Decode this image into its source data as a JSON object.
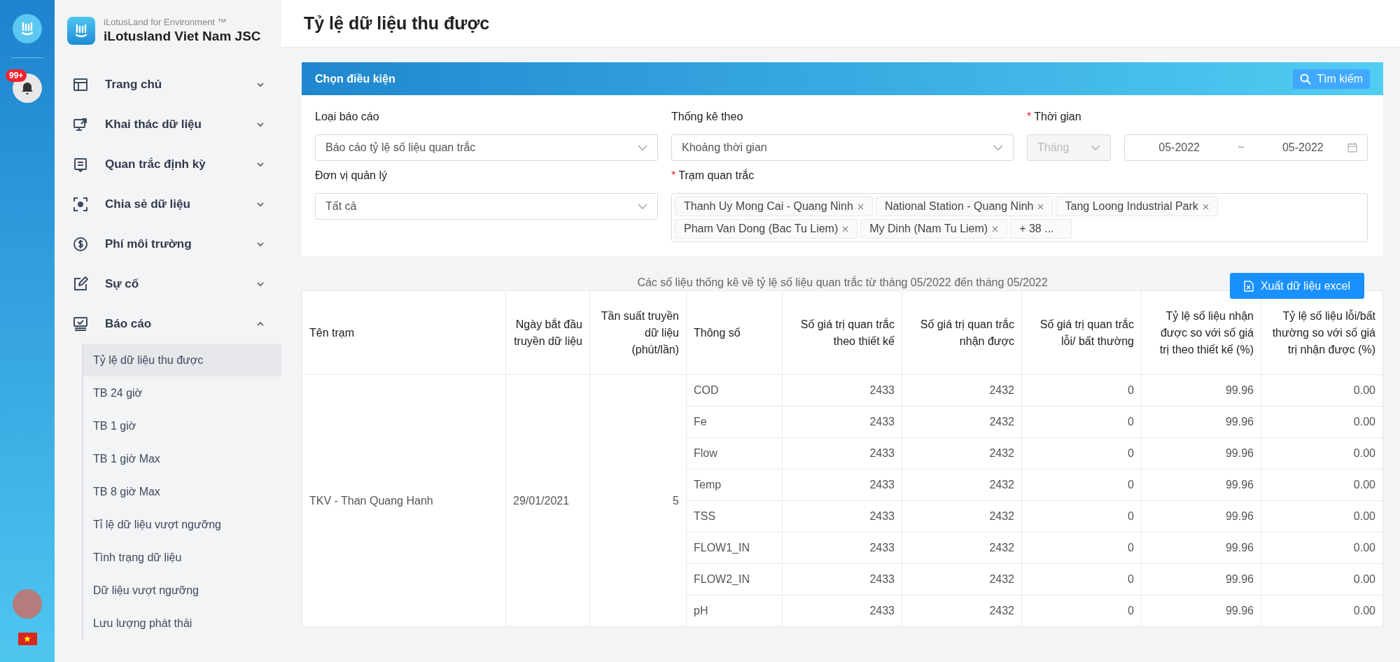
{
  "rail": {
    "notification_badge": "99+"
  },
  "sidebar": {
    "brand_subtitle": "iLotusLand for Environment ™",
    "brand_name": "iLotusland Viet Nam JSC",
    "items": [
      {
        "label": "Trang chủ",
        "kind": "layout",
        "expanded": false
      },
      {
        "label": "Khai thác dữ liệu",
        "kind": "monitor",
        "expanded": false
      },
      {
        "label": "Quan trắc định kỳ",
        "kind": "note",
        "expanded": false
      },
      {
        "label": "Chia sẻ dữ liệu",
        "kind": "focus",
        "expanded": false
      },
      {
        "label": "Phí môi trường",
        "kind": "dollar",
        "expanded": false
      },
      {
        "label": "Sự cố",
        "kind": "edit",
        "expanded": false
      },
      {
        "label": "Báo cáo",
        "kind": "report",
        "expanded": true,
        "children": [
          {
            "label": "Tỷ lệ dữ liệu thu được",
            "selected": true
          },
          {
            "label": "TB 24 giờ",
            "selected": false
          },
          {
            "label": "TB 1 giờ",
            "selected": false
          },
          {
            "label": "TB 1 giờ Max",
            "selected": false
          },
          {
            "label": "TB 8 giờ Max",
            "selected": false
          },
          {
            "label": "Tỉ lệ dữ liệu vượt ngưỡng",
            "selected": false
          },
          {
            "label": "Tình trạng dữ liệu",
            "selected": false
          },
          {
            "label": "Dữ liệu vượt ngưỡng",
            "selected": false
          },
          {
            "label": "Lưu lượng phát thải",
            "selected": false
          }
        ]
      }
    ]
  },
  "page_title": "Tỷ lệ dữ liệu thu được",
  "filter": {
    "title": "Chọn điều kiện",
    "search_button": "Tìm kiếm",
    "fields": [
      {
        "kind": "select",
        "label": "Loại báo cáo",
        "value": "Báo cáo tỷ lệ số liệu quan trắc"
      },
      {
        "kind": "select",
        "label": "Thống kê theo",
        "value": "Khoảng thời gian"
      },
      {
        "kind": "period",
        "label": "Thời gian",
        "required_mark": "*",
        "unit": {
          "value": "Tháng",
          "disabled": true
        },
        "from": "05-2022",
        "separator": "~",
        "to": "05-2022"
      },
      {
        "kind": "select",
        "label": "Đơn vị quản lý",
        "value": "Tất cả"
      },
      {
        "kind": "tags",
        "label": "Trạm quan trắc",
        "required_mark": "*",
        "tags": [
          "Thanh Uy Mong Cai - Quang Ninh",
          "National Station - Quang Ninh",
          "Tang Loong Industrial Park",
          "Pham Van Dong (Bac Tu Liem)",
          "My Dinh (Nam Tu Liem)"
        ],
        "more": "+ 38 ..."
      }
    ]
  },
  "report": {
    "caption": "Các số liệu thống kê về tỷ lệ số liệu quan trắc từ tháng 05/2022 đến tháng 05/2022",
    "export_button": "Xuất dữ liệu excel",
    "columns": [
      "Tên trạm",
      "Ngày bắt đầu truyền dữ liệu",
      "Tần suất truyền dữ liệu (phút/lần)",
      "Thông số",
      "Số giá trị quan trắc theo thiết kế",
      "Số giá trị quan trắc nhận được",
      "Số giá trị quan trắc lỗi/ bất thường",
      "Tỷ lệ số liệu nhận được so với số giá trị theo thiết kế (%)",
      "Tỷ lệ số liệu lỗi/bất thường so với số giá trị nhận được (%)"
    ],
    "stations": [
      {
        "station": "TKV - Than Quang Hanh",
        "start_date": "29/01/2021",
        "frequency": "5",
        "parameters": [
          [
            "COD",
            "2433",
            "2432",
            "0",
            "99.96",
            "0.00"
          ],
          [
            "Fe",
            "2433",
            "2432",
            "0",
            "99.96",
            "0.00"
          ],
          [
            "Flow",
            "2433",
            "2432",
            "0",
            "99.96",
            "0.00"
          ],
          [
            "Temp",
            "2433",
            "2432",
            "0",
            "99.96",
            "0.00"
          ],
          [
            "TSS",
            "2433",
            "2432",
            "0",
            "99.96",
            "0.00"
          ],
          [
            "FLOW1_IN",
            "2433",
            "2432",
            "0",
            "99.96",
            "0.00"
          ],
          [
            "FLOW2_IN",
            "2433",
            "2432",
            "0",
            "99.96",
            "0.00"
          ],
          [
            "pH",
            "2433",
            "2432",
            "0",
            "99.96",
            "0.00"
          ]
        ]
      }
    ]
  }
}
